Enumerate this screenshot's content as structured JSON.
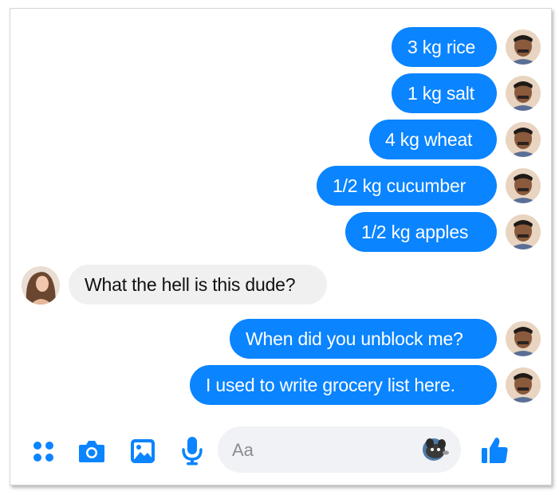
{
  "conversation": {
    "messages": [
      {
        "from": "me",
        "text": "3 kg rice"
      },
      {
        "from": "me",
        "text": "1 kg salt"
      },
      {
        "from": "me",
        "text": "4 kg wheat"
      },
      {
        "from": "me",
        "text": "1/2 kg cucumber"
      },
      {
        "from": "me",
        "text": "1/2 kg apples"
      },
      {
        "from": "them",
        "text": "What the hell is this dude?"
      },
      {
        "from": "me",
        "text": "When did you unblock me?"
      },
      {
        "from": "me",
        "text": "I used to write grocery list here."
      }
    ]
  },
  "composer": {
    "placeholder": "Aa",
    "icons": [
      "apps-icon",
      "camera-icon",
      "gallery-icon",
      "microphone-icon",
      "emoji-icon",
      "thumbs-up-icon"
    ]
  },
  "colors": {
    "outgoing_bubble": "#0a84ff",
    "incoming_bubble": "#f0f0f0",
    "accent": "#0a84ff"
  }
}
